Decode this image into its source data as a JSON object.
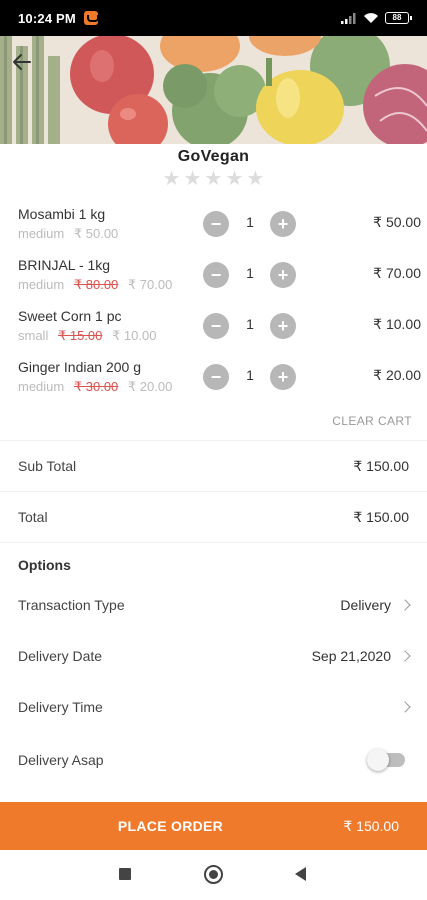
{
  "status_bar": {
    "time": "10:24 PM",
    "battery": "88"
  },
  "store": {
    "name": "GoVegan",
    "rating_stars": 5,
    "rating_filled": 0
  },
  "cart": {
    "items": [
      {
        "name": "Mosambi 1 kg",
        "variant": "medium",
        "original_price": "",
        "unit_price": "₹ 50.00",
        "qty": "1",
        "total": "₹ 50.00"
      },
      {
        "name": "BRINJAL - 1kg",
        "variant": "medium",
        "original_price": "₹ 80.00",
        "unit_price": "₹ 70.00",
        "qty": "1",
        "total": "₹ 70.00"
      },
      {
        "name": "Sweet Corn 1 pc",
        "variant": "small",
        "original_price": "₹ 15.00",
        "unit_price": "₹ 10.00",
        "qty": "1",
        "total": "₹ 10.00"
      },
      {
        "name": "Ginger Indian 200 g",
        "variant": "medium",
        "original_price": "₹ 30.00",
        "unit_price": "₹ 20.00",
        "qty": "1",
        "total": "₹ 20.00"
      }
    ],
    "clear_cart_label": "CLEAR CART"
  },
  "summary": {
    "subtotal_label": "Sub Total",
    "subtotal_value": "₹ 150.00",
    "total_label": "Total",
    "total_value": "₹ 150.00"
  },
  "options": {
    "title": "Options",
    "transaction_type_label": "Transaction Type",
    "transaction_type_value": "Delivery",
    "delivery_date_label": "Delivery Date",
    "delivery_date_value": "Sep 21,2020",
    "delivery_time_label": "Delivery Time",
    "delivery_time_value": "",
    "delivery_asap_label": "Delivery Asap",
    "delivery_asap_on": false
  },
  "footer": {
    "place_order_label": "PLACE ORDER",
    "order_total": "₹ 150.00"
  },
  "colors": {
    "accent": "#f07a2c",
    "strike": "#d9534f",
    "muted": "#bbbbbb"
  },
  "icons": [
    "back-arrow-icon",
    "minus-icon",
    "plus-icon",
    "chevron-right-icon",
    "wifi-icon",
    "signal-icon",
    "battery-icon"
  ]
}
